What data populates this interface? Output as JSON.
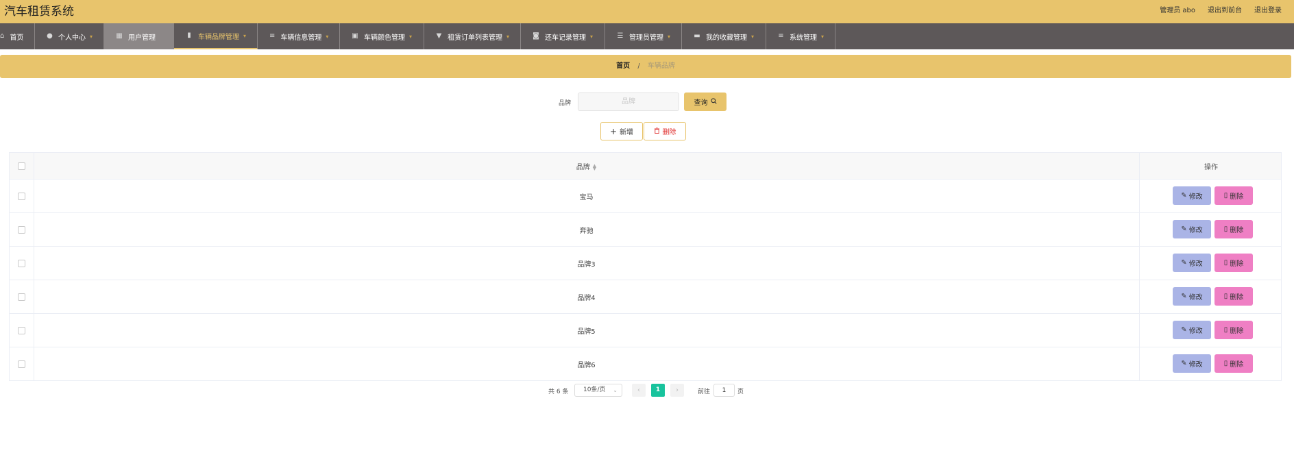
{
  "header": {
    "title": "汽车租赁系统",
    "links": [
      "管理员 abo",
      "退出到前台",
      "退出登录"
    ]
  },
  "nav": {
    "items": [
      {
        "label": "首页",
        "icon": "home-icon",
        "caret": false
      },
      {
        "label": "个人中心",
        "icon": "user-icon",
        "caret": true
      },
      {
        "label": "用户管理",
        "icon": "grid-icon",
        "caret": false,
        "state": "hovered"
      },
      {
        "label": "车辆品牌管理",
        "icon": "book-icon",
        "caret": true,
        "state": "active"
      },
      {
        "label": "车辆信息管理",
        "icon": "list-icon",
        "caret": true
      },
      {
        "label": "车辆颜色管理",
        "icon": "clipboard-icon",
        "caret": true
      },
      {
        "label": "租赁订单列表管理",
        "icon": "filter-icon",
        "caret": true
      },
      {
        "label": "还车记录管理",
        "icon": "briefcase-icon",
        "caret": true
      },
      {
        "label": "管理员管理",
        "icon": "sliders-icon",
        "caret": true
      },
      {
        "label": "我的收藏管理",
        "icon": "film-icon",
        "caret": true
      },
      {
        "label": "系统管理",
        "icon": "list-icon",
        "caret": true
      }
    ]
  },
  "breadcrumb": {
    "home": "首页",
    "separator": "/",
    "current": "车辆品牌"
  },
  "search": {
    "label": "品牌",
    "placeholder": "品牌",
    "query_label": "查询"
  },
  "actions": {
    "add_label": "新增",
    "delete_label": "删除"
  },
  "table": {
    "headers": {
      "brand": "品牌",
      "operation": "操作"
    },
    "edit_label": "修改",
    "delete_label": "删除",
    "rows": [
      {
        "brand": "宝马"
      },
      {
        "brand": "奔驰"
      },
      {
        "brand": "品牌3"
      },
      {
        "brand": "品牌4"
      },
      {
        "brand": "品牌5"
      },
      {
        "brand": "品牌6"
      }
    ]
  },
  "pagination": {
    "total_text": "共 6 条",
    "page_size": "10条/页",
    "current_page": "1",
    "goto_label": "前往",
    "goto_value": "1",
    "page_suffix": "页"
  },
  "colors": {
    "accent": "#e8c46c",
    "nav_bg": "#5d5859",
    "edit_btn": "#aab4e6",
    "delete_btn": "#ef7fc4",
    "page_active": "#18c39d",
    "danger_text": "#e0302f"
  }
}
